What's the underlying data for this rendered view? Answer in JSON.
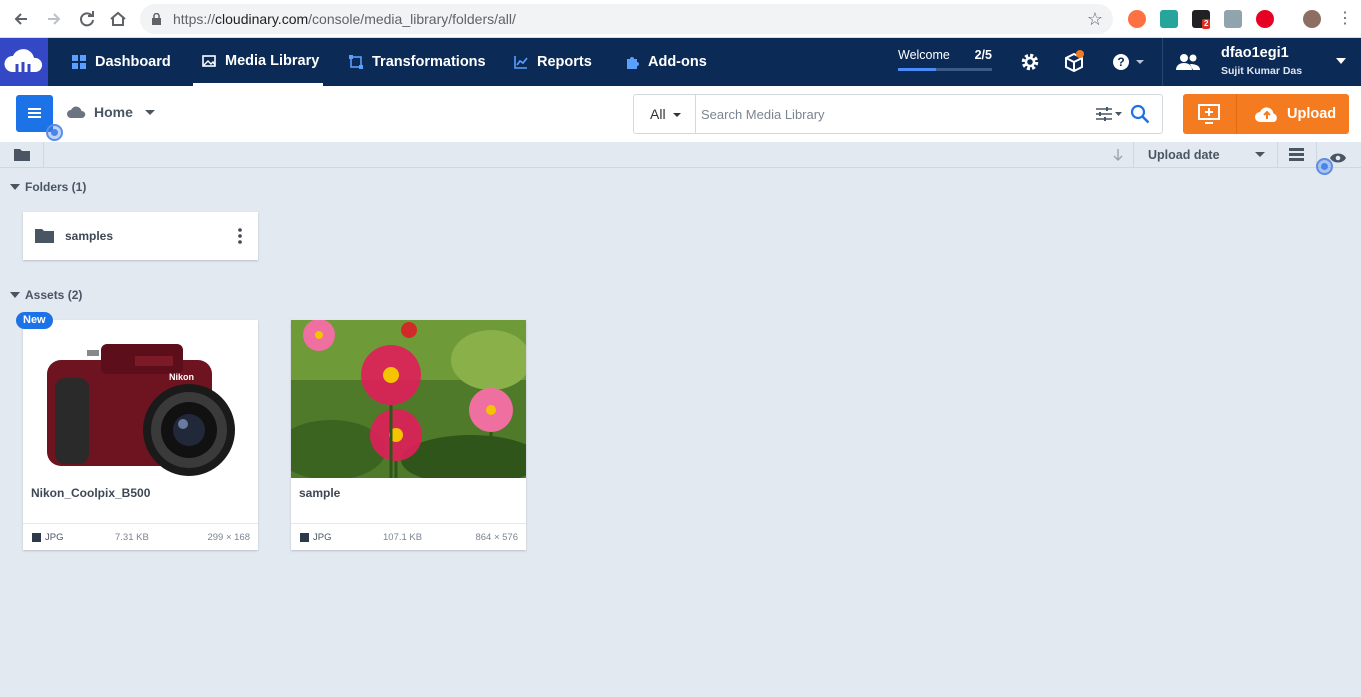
{
  "browser": {
    "url_prefix": "https://",
    "url_domain": "cloudinary.com",
    "url_path": "/console/media_library/folders/all/",
    "ext_badge": "2"
  },
  "topnav": {
    "items": [
      {
        "label": "Dashboard",
        "icon": "dashboard-icon"
      },
      {
        "label": "Media Library",
        "icon": "media-library-icon"
      },
      {
        "label": "Transformations",
        "icon": "transformations-icon"
      },
      {
        "label": "Reports",
        "icon": "reports-icon"
      },
      {
        "label": "Add-ons",
        "icon": "puzzle-icon"
      }
    ],
    "active": "Media Library",
    "welcome_label": "Welcome",
    "welcome_progress": "2/5",
    "welcome_fraction": 0.4,
    "user_name": "dfao1egi1",
    "user_sub": "Sujit Kumar Das"
  },
  "toolbar": {
    "home_label": "Home",
    "search_scope": "All",
    "search_placeholder": "Search Media Library",
    "upload_label": "Upload"
  },
  "sortbar": {
    "sort_label": "Upload date"
  },
  "folders": {
    "title": "Folders (1)",
    "items": [
      {
        "name": "samples"
      }
    ]
  },
  "assets": {
    "title": "Assets (2)",
    "new_badge": "New",
    "items": [
      {
        "name": "Nikon_Coolpix_B500",
        "format": "JPG",
        "size": "7.31 KB",
        "dims": "299 × 168"
      },
      {
        "name": "sample",
        "format": "JPG",
        "size": "107.1 KB",
        "dims": "864 × 576"
      }
    ]
  },
  "colors": {
    "topbar": "#0b2a55",
    "accent": "#1c73e8",
    "upload": "#f47b1f",
    "page_bg": "#e3e9f1"
  }
}
